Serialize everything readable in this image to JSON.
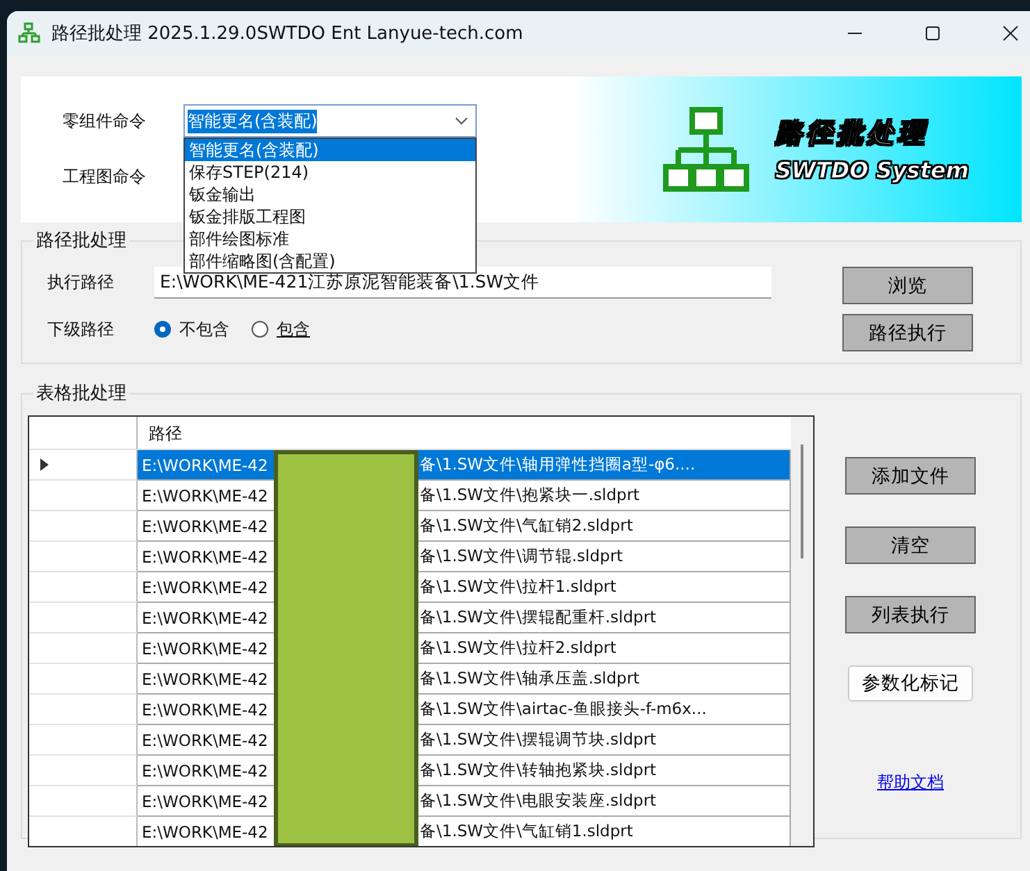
{
  "window": {
    "title": "路径批处理 2025.1.29.0SWTDO Ent Lanyue-tech.com"
  },
  "commands": {
    "part_label": "零组件命令",
    "part_value": "智能更名(含装配)",
    "expanded": true,
    "options": [
      {
        "label": "智能更名(含装配)",
        "selected": true
      },
      {
        "label": "保存STEP(214)",
        "selected": false
      },
      {
        "label": "钣金输出",
        "selected": false
      },
      {
        "label": "钣金排版工程图",
        "selected": false
      },
      {
        "label": "部件绘图标准",
        "selected": false
      },
      {
        "label": "部件缩略图(含配置)",
        "selected": false
      }
    ],
    "drawing_label": "工程图命令"
  },
  "banner": {
    "title": "路径批处理",
    "subtitle": "SWTDO System"
  },
  "path_group": {
    "title": "路径批处理",
    "exec_label": "执行路径",
    "exec_value": "E:\\WORK\\ME-421江苏原泥智能装备\\1.SW文件",
    "sub_label": "下级路径",
    "radios": [
      {
        "label": "不包含",
        "selected": true,
        "underline": false
      },
      {
        "label": "包含",
        "selected": false,
        "underline": true
      }
    ],
    "buttons": [
      "浏览",
      "路径执行"
    ]
  },
  "table_group": {
    "title": "表格批处理",
    "columns": [
      "路径"
    ],
    "rows": [
      {
        "selected": true,
        "current": true,
        "start": "E:\\WORK\\ME-42",
        "end": "备\\1.SW文件\\轴用弹性挡圈a型-φ6...."
      },
      {
        "selected": false,
        "current": false,
        "start": "E:\\WORK\\ME-42",
        "end": "备\\1.SW文件\\抱紧块一.sldprt"
      },
      {
        "selected": false,
        "current": false,
        "start": "E:\\WORK\\ME-42",
        "end": "备\\1.SW文件\\气缸销2.sldprt"
      },
      {
        "selected": false,
        "current": false,
        "start": "E:\\WORK\\ME-42",
        "end": "备\\1.SW文件\\调节辊.sldprt"
      },
      {
        "selected": false,
        "current": false,
        "start": "E:\\WORK\\ME-42",
        "end": "备\\1.SW文件\\拉杆1.sldprt"
      },
      {
        "selected": false,
        "current": false,
        "start": "E:\\WORK\\ME-42",
        "end": "备\\1.SW文件\\摆辊配重杆.sldprt"
      },
      {
        "selected": false,
        "current": false,
        "start": "E:\\WORK\\ME-42",
        "end": "备\\1.SW文件\\拉杆2.sldprt"
      },
      {
        "selected": false,
        "current": false,
        "start": "E:\\WORK\\ME-42",
        "end": "备\\1.SW文件\\轴承压盖.sldprt"
      },
      {
        "selected": false,
        "current": false,
        "start": "E:\\WORK\\ME-42",
        "end": "备\\1.SW文件\\airtac-鱼眼接头-f-m6x..."
      },
      {
        "selected": false,
        "current": false,
        "start": "E:\\WORK\\ME-42",
        "end": "备\\1.SW文件\\摆辊调节块.sldprt"
      },
      {
        "selected": false,
        "current": false,
        "start": "E:\\WORK\\ME-42",
        "end": "备\\1.SW文件\\转轴抱紧块.sldprt"
      },
      {
        "selected": false,
        "current": false,
        "start": "E:\\WORK\\ME-42",
        "end": "备\\1.SW文件\\电眼安装座.sldprt"
      },
      {
        "selected": false,
        "current": false,
        "start": "E:\\WORK\\ME-42",
        "end": "备\\1.SW文件\\气缸销1.sldprt"
      }
    ],
    "buttons": [
      {
        "label": "添加文件",
        "kind": "flat"
      },
      {
        "label": "清空",
        "kind": "flat"
      },
      {
        "label": "列表执行",
        "kind": "flat"
      },
      {
        "label": "参数化标记",
        "kind": "raised"
      }
    ],
    "link": "帮助文档"
  }
}
